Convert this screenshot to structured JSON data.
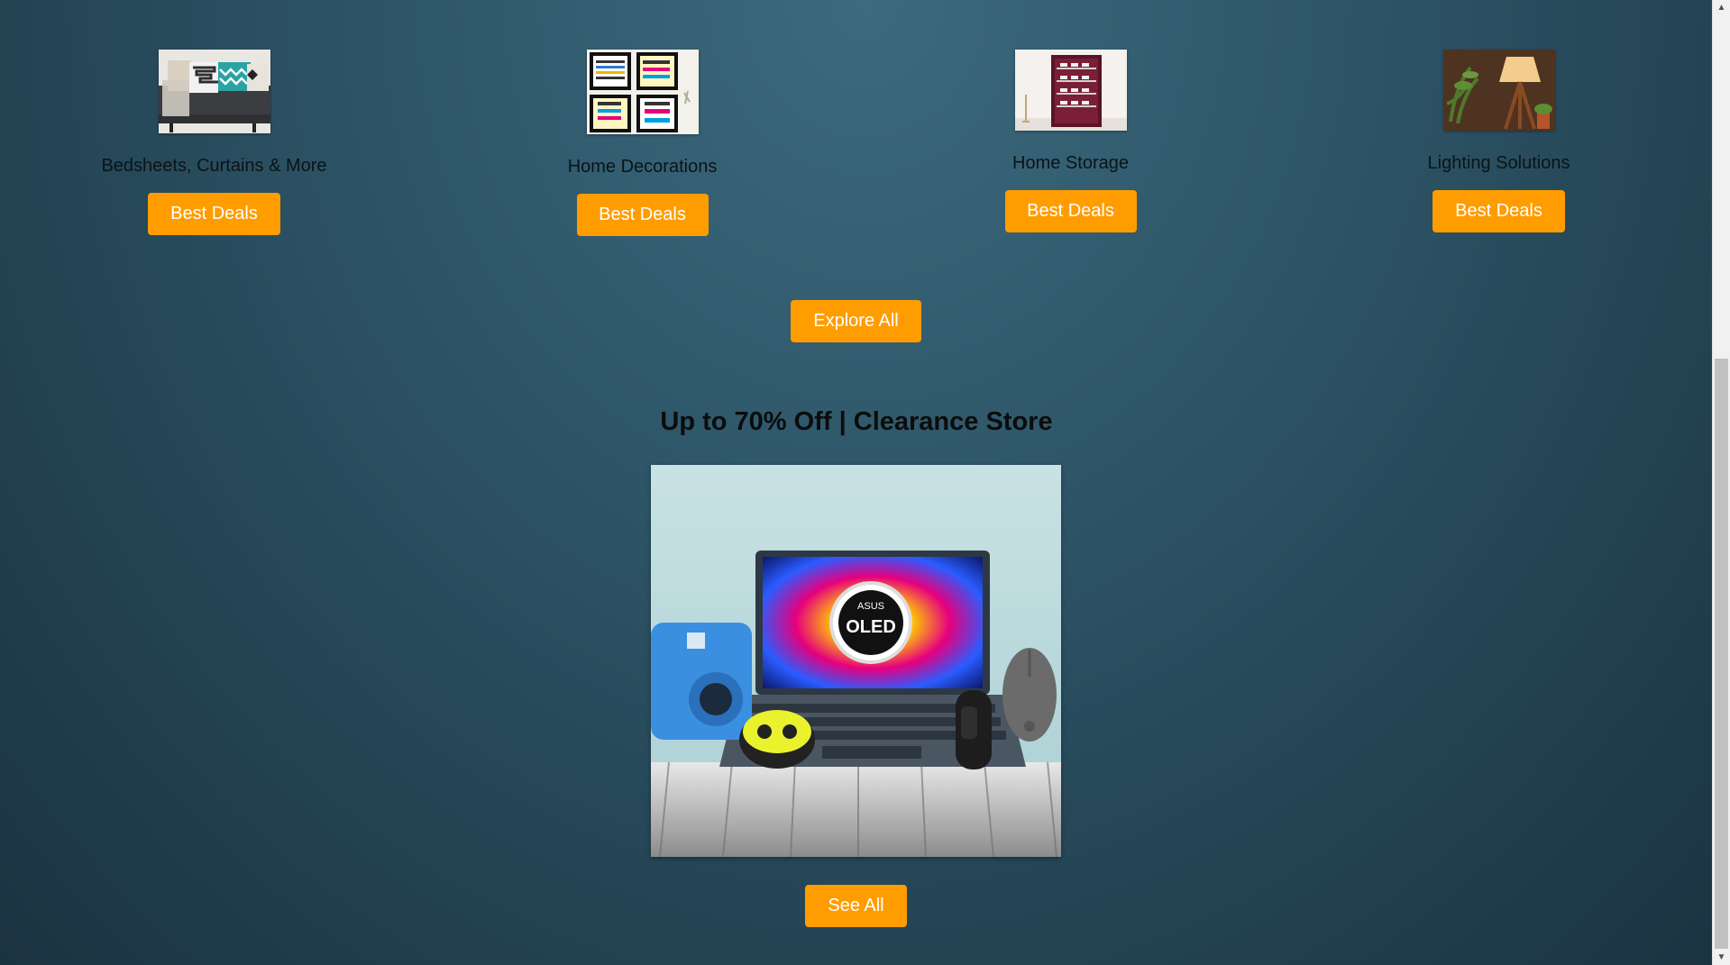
{
  "categories": [
    {
      "label": "Bedsheets, Curtains & More",
      "button": "Best Deals",
      "image": "sofa-pillows-image"
    },
    {
      "label": "Home Decorations",
      "button": "Best Deals",
      "image": "wall-frames-image"
    },
    {
      "label": "Home Storage",
      "button": "Best Deals",
      "image": "shoe-rack-image"
    },
    {
      "label": "Lighting Solutions",
      "button": "Best Deals",
      "image": "lamp-image"
    }
  ],
  "explore_button": "Explore All",
  "clearance": {
    "title": "Up to 70% Off | Clearance Store",
    "banner_brand": "ASUS",
    "banner_text": "OLED",
    "see_all_button": "See All"
  },
  "colors": {
    "button_bg": "#ff9d00",
    "button_text": "#ffffff",
    "background": "#2d5567"
  },
  "scrollbar": {
    "up_icon": "triangle-up",
    "down_icon": "triangle-down"
  }
}
